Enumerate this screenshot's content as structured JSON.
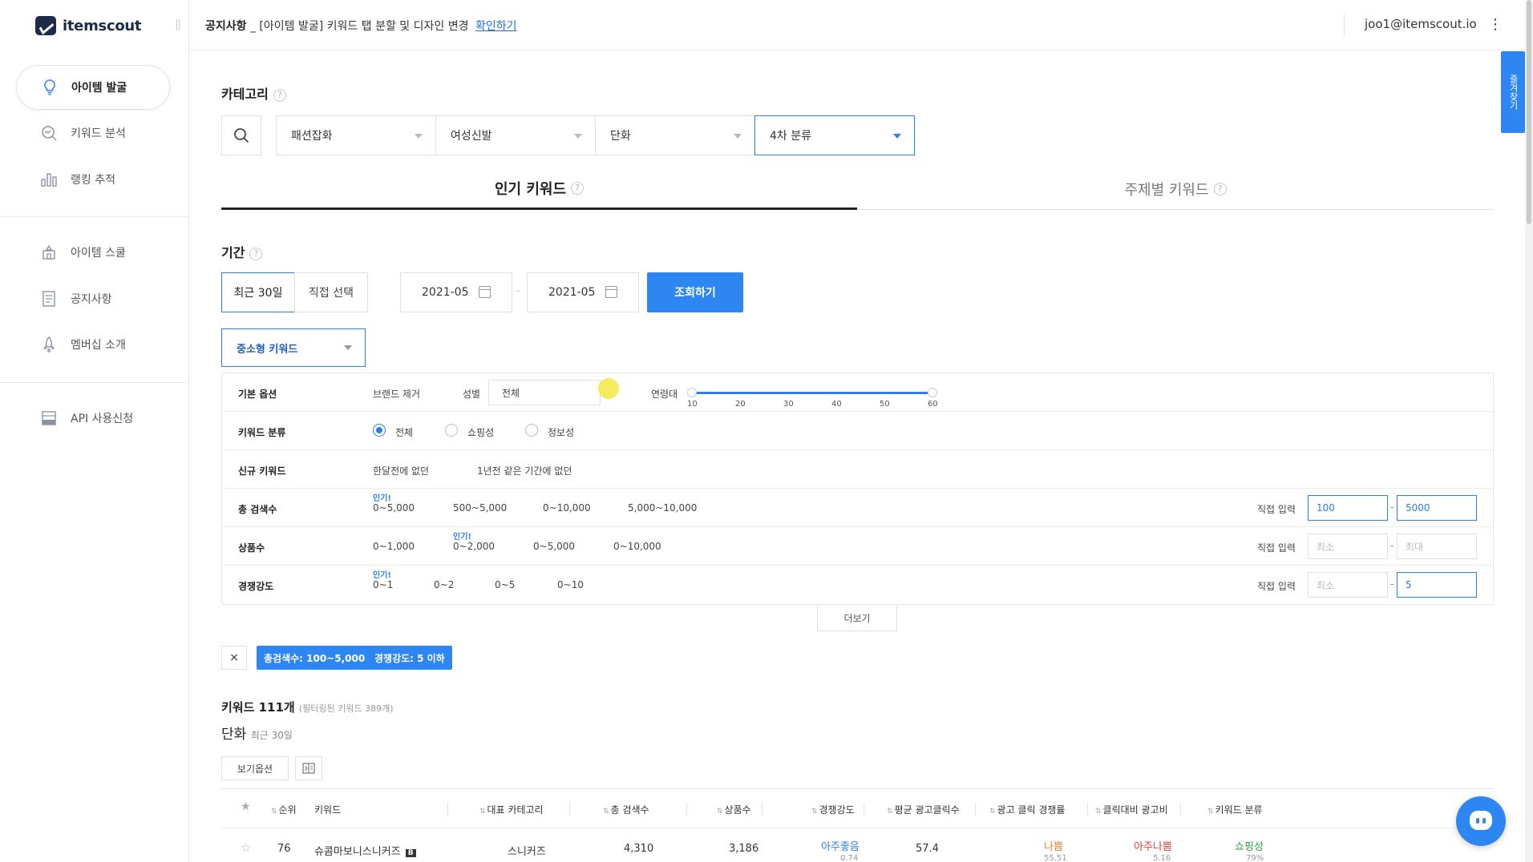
{
  "brand": {
    "name": "itemscout",
    "accent": "#2d86f2"
  },
  "sidebar": {
    "items": [
      {
        "label": "아이템 발굴",
        "icon": "lightbulb-icon",
        "active": true
      },
      {
        "label": "키워드 분석",
        "icon": "magnifier-chart-icon"
      },
      {
        "label": "랭킹 추적",
        "icon": "bar-chart-icon"
      },
      {
        "label": "아이템 스쿨",
        "icon": "school-icon"
      },
      {
        "label": "공지사항",
        "icon": "document-icon"
      },
      {
        "label": "멤버십 소개",
        "icon": "rocket-icon"
      },
      {
        "label": "API 사용신청",
        "icon": "api-icon"
      }
    ]
  },
  "header": {
    "notice_label": "공지사항",
    "notice_text": "_ [아이템 발굴] 키워드 탭 분할 및 디자인 변경",
    "notice_link": "확인하기",
    "email": "joo1@itemscout.io"
  },
  "side_tab": {
    "label": "즐겨찾기"
  },
  "category": {
    "title": "카테고리",
    "selects": [
      "패션잡화",
      "여성신발",
      "단화",
      "4차 분류"
    ]
  },
  "keyword_tabs": [
    "인기 키워드",
    "주제별 키워드"
  ],
  "period": {
    "title": "기간",
    "buttons": [
      "최근 30일",
      "직접 선택"
    ],
    "start": "2021-05",
    "end": "2021-05",
    "search_button": "조회하기"
  },
  "keyword_type_select": "중소형 키워드",
  "filters": {
    "basic": {
      "label": "기본 옵션",
      "brand": "브랜드 제거",
      "gender_label": "성별",
      "gender_value": "전체",
      "age_label": "연령대",
      "age_ticks": [
        "10",
        "20",
        "30",
        "40",
        "50",
        "60"
      ],
      "age_range": [
        10,
        60
      ]
    },
    "classify": {
      "label": "키워드 분류",
      "options": [
        "전체",
        "쇼핑성",
        "정보성"
      ],
      "selected": "전체"
    },
    "new_keyword": {
      "label": "신규 키워드",
      "options": [
        "한달전에 없던",
        "1년전 같은 기간에 없던"
      ]
    },
    "total_search": {
      "label": "총 검색수",
      "popular": "인기!",
      "options": [
        "0~5,000",
        "500~5,000",
        "0~10,000",
        "5,000~10,000"
      ],
      "direct": "직접 입력",
      "min": "100",
      "max": "5000"
    },
    "products": {
      "label": "상품수",
      "popular": "인기!",
      "options": [
        "0~1,000",
        "0~2,000",
        "0~5,000",
        "0~10,000"
      ],
      "direct": "직접 입력",
      "min_placeholder": "최소",
      "max_placeholder": "최대"
    },
    "competition": {
      "label": "경쟁강도",
      "popular": "인기!",
      "options": [
        "0~1",
        "0~2",
        "0~5",
        "0~10"
      ],
      "direct": "직접 입력",
      "min_placeholder": "최소",
      "max": "5"
    },
    "more_button": "더보기"
  },
  "chips": {
    "clear": "×",
    "items": [
      "총검색수: 100~5,000",
      "경쟁강도: 5 이하"
    ]
  },
  "results": {
    "title": "키워드 111개",
    "subtitle": "(필터링된 키워드 389개)",
    "category": "단화",
    "period": "최근 30일",
    "view_options": "보기옵션"
  },
  "table": {
    "headers": [
      "순위",
      "키워드",
      "대표 카테고리",
      "총 검색수",
      "상품수",
      "경쟁강도",
      "평균 광고클릭수",
      "광고 클릭 경쟁률",
      "클릭대비 광고비",
      "키워드 분류"
    ],
    "row": {
      "rank": "76",
      "keyword": "슈콤마보니스니커즈",
      "badge": "B",
      "category": "스니커즈",
      "searches": "4,310",
      "products": "3,186",
      "competition": "아주좋음",
      "competition_sub": "0.74",
      "avg_clicks": "57.4",
      "click_comp": "나쁨",
      "click_comp_sub": "55.51",
      "cost": "아주나쁨",
      "cost_sub": "5.16",
      "kind": "쇼핑성",
      "kind_sub": "79%"
    }
  }
}
